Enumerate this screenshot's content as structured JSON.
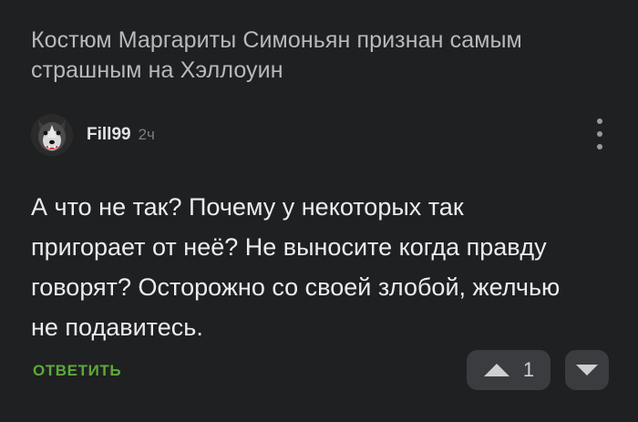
{
  "post": {
    "title": "Костюм Маргариты Симоньян признан самым страшным на Хэллоуин"
  },
  "comment": {
    "avatar_icon": "husky-dog-avatar",
    "author": "Fill99",
    "time": "2ч",
    "text": "А что не так? Почему у некоторых так пригорает от неё? Не выносите когда правду говорят? Осторожно со своей злобой, желчью не подавитесь.",
    "reply_label": "ОТВЕТИТЬ",
    "score": "1",
    "more_icon": "vertical-ellipsis-icon",
    "upvote_icon": "triangle-up-icon",
    "downvote_icon": "triangle-down-icon"
  },
  "colors": {
    "background": "#1f2022",
    "reply_accent": "#5fa83a",
    "button_background": "#3b3c3f"
  }
}
